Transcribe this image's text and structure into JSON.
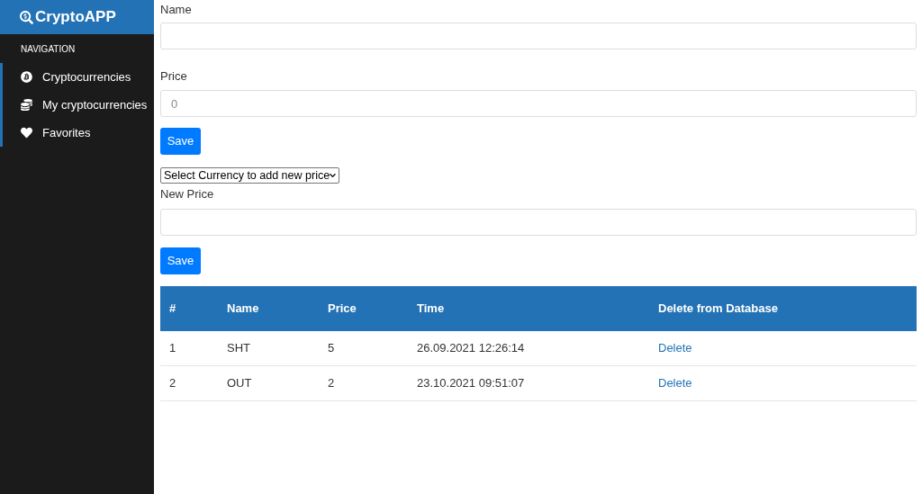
{
  "sidebar": {
    "brand": "CryptoAPP",
    "section_title": "NAVIGATION",
    "items": [
      {
        "label": "Cryptocurrencies",
        "kind": "bitcoin"
      },
      {
        "label": "My cryptocurrencies",
        "kind": "coins"
      },
      {
        "label": "Favorites",
        "kind": "heart"
      }
    ]
  },
  "form": {
    "name_label": "Name",
    "price_label": "Price",
    "price_placeholder": "0",
    "save": "Save"
  },
  "price_form": {
    "select": "Select Currency to add new price",
    "new_price_label": "New Price",
    "save": "Save"
  },
  "table": {
    "columns": [
      "#",
      "Name",
      "Price",
      "Time",
      "Delete from Database"
    ],
    "rows": [
      {
        "cells": [
          "1",
          "SHT",
          "5",
          "26.09.2021 12:26:14"
        ],
        "action": "Delete"
      },
      {
        "cells": [
          "2",
          "OUT",
          "2",
          "23.10.2021 09:51:07"
        ],
        "action": "Delete"
      }
    ]
  }
}
